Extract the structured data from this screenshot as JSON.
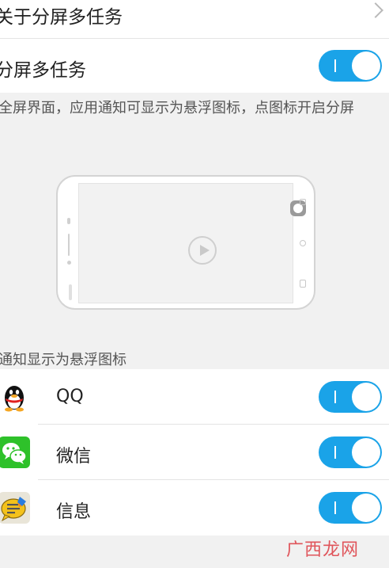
{
  "rows": {
    "about": {
      "title": "关于分屏多任务",
      "icon": "chevron-right-icon"
    },
    "split": {
      "title": "分屏多任务",
      "enabled": true
    }
  },
  "description": "全屏界面，应用通知可显示为悬浮图标，点图标开启分屏",
  "section_label": "通知显示为悬浮图标",
  "apps": [
    {
      "name": "QQ",
      "icon": "qq-penguin-icon",
      "enabled": true
    },
    {
      "name": "微信",
      "icon": "wechat-icon",
      "enabled": true
    },
    {
      "name": "信息",
      "icon": "messages-icon",
      "enabled": true
    }
  ],
  "watermark": "广西龙网",
  "colors": {
    "toggle_on": "#1aa3e8",
    "wechat_green": "#2ec12a",
    "watermark": "#e0555b"
  }
}
